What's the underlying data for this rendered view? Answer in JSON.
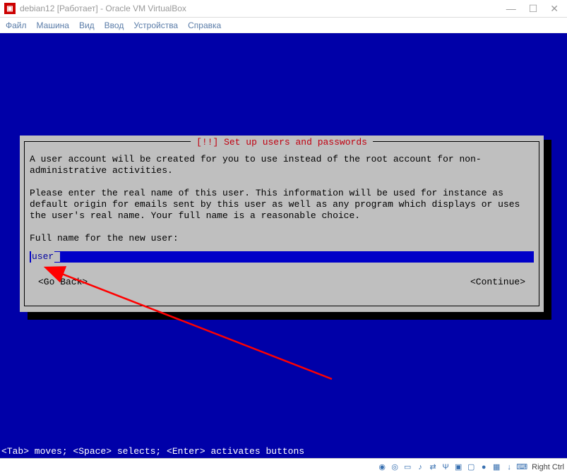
{
  "window": {
    "title": "debian12 [Работает] - Oracle VM VirtualBox"
  },
  "menu": {
    "file": "Файл",
    "machine": "Машина",
    "view": "Вид",
    "input": "Ввод",
    "devices": "Устройства",
    "help": "Справка"
  },
  "dialog": {
    "title": "[!!] Set up users and passwords",
    "para1": "A user account will be created for you to use instead of the root account for non-administrative activities.",
    "para2": "Please enter the real name of this user. This information will be used for instance as default origin for emails sent by this user as well as any program which displays or uses the user's real name. Your full name is a reasonable choice.",
    "prompt": "Full name for the new user:",
    "input_value": "user",
    "go_back": "<Go Back>",
    "cont": "<Continue>"
  },
  "helpbar": "<Tab> moves; <Space> selects; <Enter> activates buttons",
  "statusbar": {
    "hostkey": "Right Ctrl"
  }
}
